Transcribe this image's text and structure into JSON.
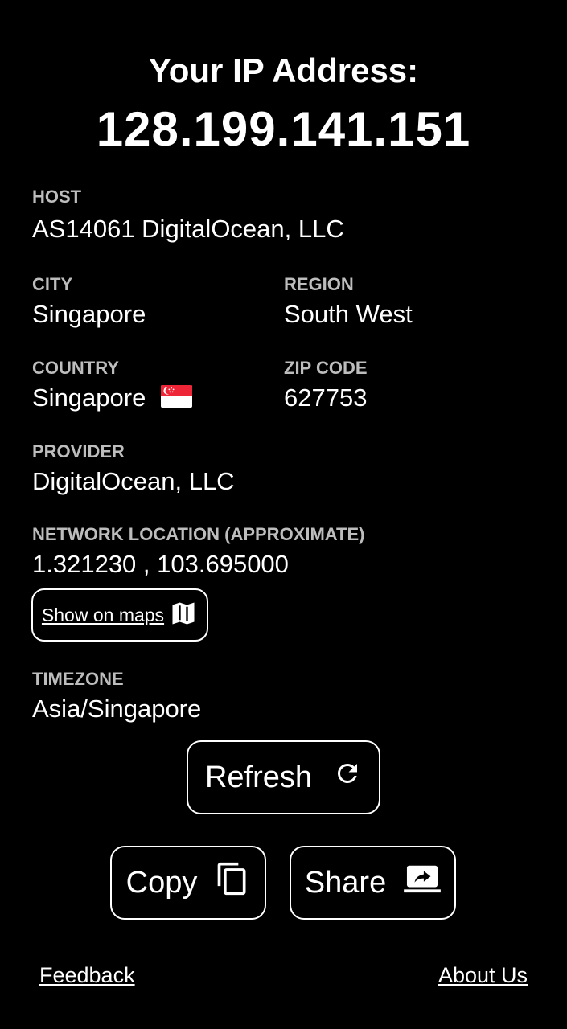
{
  "header": {
    "title": "Your IP Address:",
    "ip": "128.199.141.151"
  },
  "info": {
    "host": {
      "label": "HOST",
      "value": "AS14061 DigitalOcean, LLC"
    },
    "city": {
      "label": "CITY",
      "value": "Singapore"
    },
    "region": {
      "label": "REGION",
      "value": "South West"
    },
    "country": {
      "label": "COUNTRY",
      "value": "Singapore",
      "flag": "singapore-flag"
    },
    "zip": {
      "label": "ZIP CODE",
      "value": "627753"
    },
    "provider": {
      "label": "PROVIDER",
      "value": "DigitalOcean, LLC"
    },
    "location": {
      "label": "NETWORK LOCATION (APPROXIMATE)",
      "value": "1.321230 , 103.695000"
    },
    "timezone": {
      "label": "TIMEZONE",
      "value": "Asia/Singapore"
    }
  },
  "actions": {
    "maps_label": "Show on maps",
    "refresh_label": "Refresh",
    "copy_label": "Copy",
    "share_label": "Share"
  },
  "footer": {
    "feedback": "Feedback",
    "about": "About Us"
  },
  "colors": {
    "background": "#000000",
    "text": "#ffffff",
    "label": "#bdbdbd",
    "flag_red": "#ee2536"
  }
}
